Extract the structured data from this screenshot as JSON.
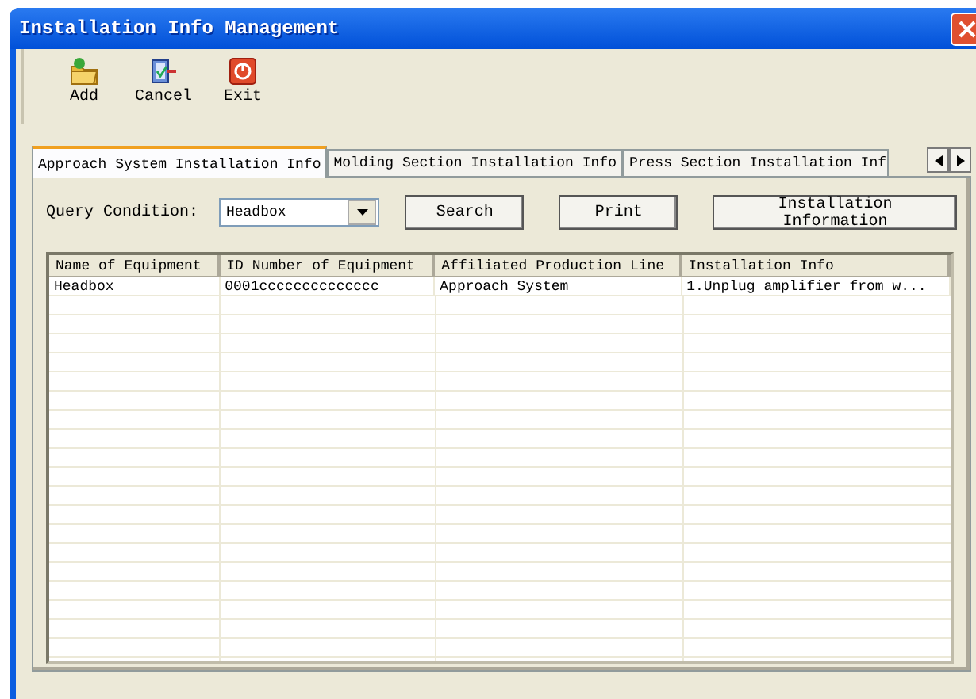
{
  "window": {
    "title": "Installation Info Management"
  },
  "toolbar": [
    {
      "kind": "add",
      "label": "Add"
    },
    {
      "kind": "cancel",
      "label": "Cancel"
    },
    {
      "kind": "exit",
      "label": "Exit"
    }
  ],
  "tabs": [
    {
      "label": "Approach System Installation Info",
      "selected": true
    },
    {
      "label": "Molding Section Installation Info",
      "selected": false
    },
    {
      "label": "Press Section Installation Inf",
      "selected": false
    }
  ],
  "query": {
    "label": "Query Condition:",
    "value": "Headbox",
    "buttons": [
      "Search",
      "Print",
      "Installation Information"
    ]
  },
  "table": {
    "columns": [
      "Name of Equipment",
      "ID Number of Equipment",
      "Affiliated Production Line",
      "Installation Info"
    ],
    "rows": [
      [
        "Headbox",
        "0001cccccccccccccc",
        "Approach System",
        "1.Unplug amplifier from w..."
      ]
    ]
  }
}
